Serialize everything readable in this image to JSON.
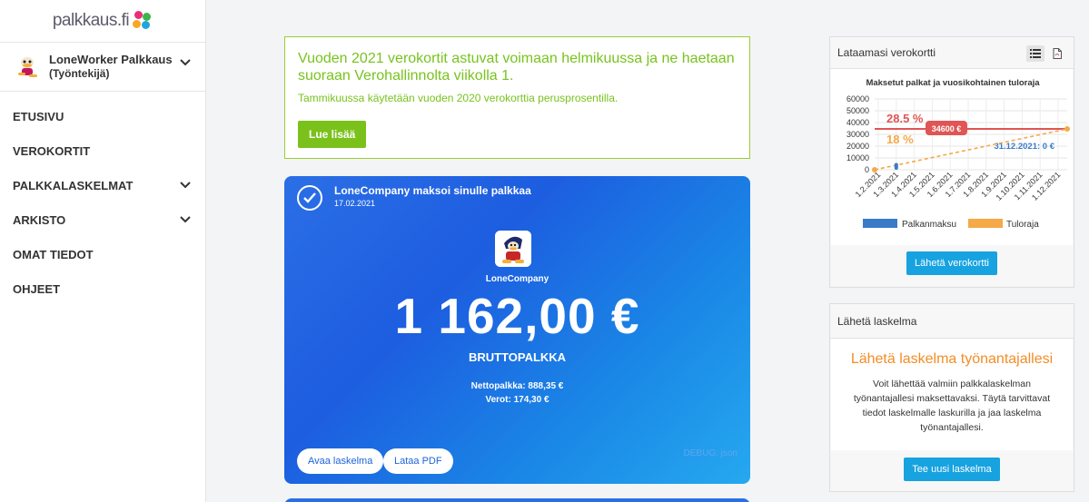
{
  "sidebar": {
    "logo_text": "palkkaus.fi",
    "user": {
      "name": "LoneWorker Palkkaus",
      "role": "(Työntekijä)"
    },
    "nav": [
      {
        "label": "ETUSIVU"
      },
      {
        "label": "VEROKORTIT"
      },
      {
        "label": "PALKKALASKELMAT"
      },
      {
        "label": "ARKISTO"
      },
      {
        "label": "OMAT TIEDOT"
      },
      {
        "label": "OHJEET"
      }
    ]
  },
  "banner": {
    "title": "Vuoden 2021 verokortit astuvat voimaan helmikuussa ja ne haetaan suoraan Verohallinnolta viikolla 1.",
    "subtitle": "Tammikuussa käytetään vuoden 2020 verokorttia perusprosentilla.",
    "button": "Lue lisää"
  },
  "paycard": {
    "title": "LoneCompany maksoi sinulle palkkaa",
    "date": "17.02.2021",
    "company": "LoneCompany",
    "amount": "1 162,00 €",
    "amount_label": "BRUTTOPALKKA",
    "net": "Nettopalkka: 888,35 €",
    "tax": "Verot: 174,30 €",
    "btn_open": "Avaa laskelma",
    "btn_pdf": "Lataa PDF",
    "debug": "DEBUG: json"
  },
  "taxcard_panel": {
    "title": "Lataamasi verokortti",
    "button": "Lähetä verokortti"
  },
  "send_panel": {
    "title": "Lähetä laskelma",
    "heading": "Lähetä laskelma työnantajallesi",
    "text": "Voit lähettää valmiin palkkalaskelman työnantajallesi maksettavaksi. Täytä tarvittavat tiedot laskelmalle laskurilla ja jaa laskelma työnantajallesi.",
    "button": "Tee uusi laskelma"
  },
  "chart_data": {
    "type": "line",
    "title": "Maksetut palkat ja vuosikohtainen tuloraja",
    "categories": [
      "1.2.2021",
      "1.3.2021",
      "1.4.2021",
      "1.5.2021",
      "1.6.2021",
      "1.7.2021",
      "1.8.2021",
      "1.9.2021",
      "1.10.2021",
      "1.11.2021",
      "1.12.2021"
    ],
    "ylim": [
      0,
      60000
    ],
    "yticks": [
      "60000",
      "50000",
      "40000",
      "30000",
      "20000",
      "10000",
      "0"
    ],
    "rate_high": "28.5 %",
    "rate_low": "18 %",
    "limit_label": "34600 €",
    "end_label": "31.12.2021: 0 €",
    "limit_value": 34600,
    "series": [
      {
        "name": "Palkanmaksu",
        "values": [
          1162
        ],
        "color": "#3a7bc8"
      },
      {
        "name": "Tuloraja",
        "values": [
          0,
          34600
        ],
        "color": "#f5a947"
      }
    ]
  }
}
